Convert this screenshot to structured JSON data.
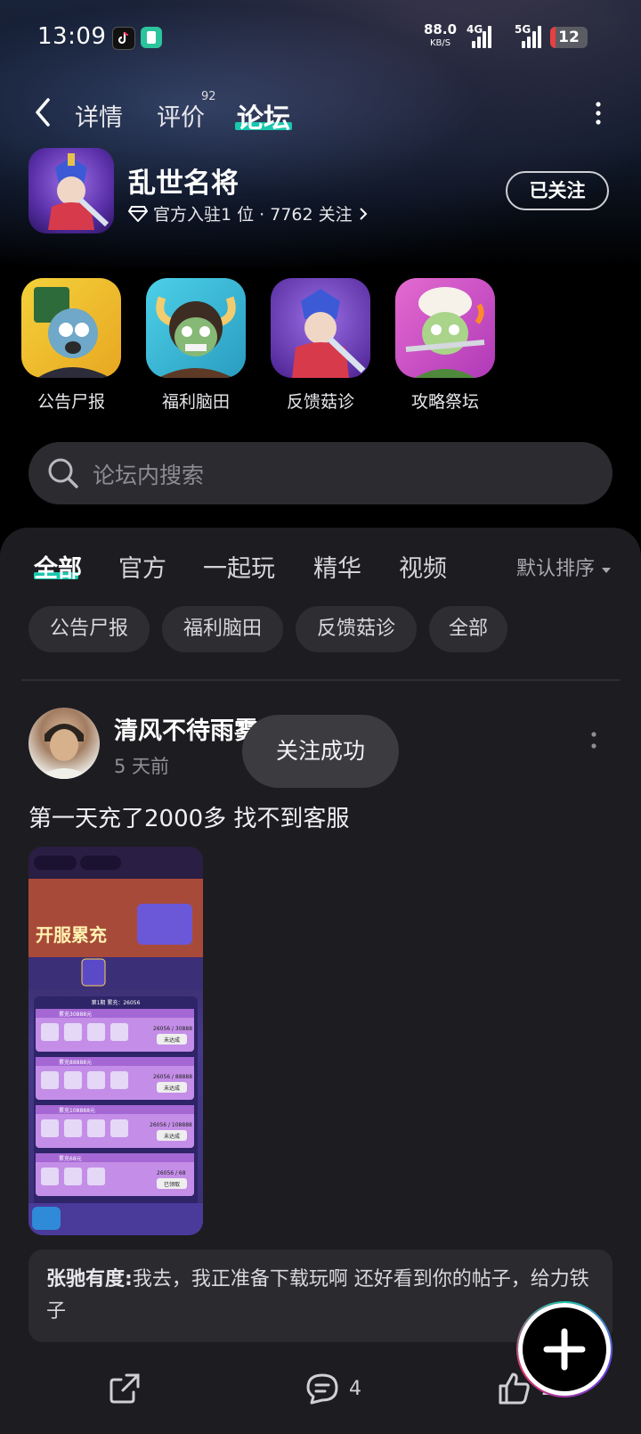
{
  "status_bar": {
    "time": "13:09",
    "net_speed": "88.0",
    "net_unit": "KB/S",
    "net1": "4G",
    "net2": "5G",
    "battery": "12"
  },
  "nav": {
    "tabs": [
      {
        "label": "详情"
      },
      {
        "label": "评价",
        "badge": "92"
      },
      {
        "label": "论坛"
      }
    ]
  },
  "game": {
    "title": "乱世名将",
    "meta": "官方入驻1 位 · 7762 关注",
    "follow_label": "已关注"
  },
  "sections": [
    {
      "label": "公告尸报"
    },
    {
      "label": "福利脑田"
    },
    {
      "label": "反馈菇诊"
    },
    {
      "label": "攻略祭坛"
    }
  ],
  "search": {
    "placeholder": "论坛内搜索"
  },
  "feed_tabs": [
    "全部",
    "官方",
    "一起玩",
    "精华",
    "视频"
  ],
  "sort_label": "默认排序",
  "chips": [
    "公告尸报",
    "福利脑田",
    "反馈菇诊",
    "全部"
  ],
  "post": {
    "author": "清风不待雨雾",
    "time": "5 天前",
    "text": "第一天充了2000多 找不到客服",
    "comment_author": "张驰有度:",
    "comment_text": "我去，我正准备下载玩啊 还好看到你的帖子，给力铁子",
    "comment_count": "4",
    "like_count": "2"
  },
  "toast": "关注成功",
  "image_texts": {
    "banner": "开服累充",
    "progress": "第1期 累充：26056",
    "rows": [
      {
        "tier": "累充30888元",
        "progress": "26056 / 30888",
        "status": "未达成"
      },
      {
        "tier": "累充88888元",
        "progress": "26056 / 88888",
        "status": "未达成"
      },
      {
        "tier": "累充108888元",
        "progress": "26056 / 108888",
        "status": "未达成"
      },
      {
        "tier": "累充68元",
        "progress": "26056 / 68",
        "status": "已领取"
      }
    ]
  },
  "colors": {
    "accent": "#19c7ad",
    "panel": "#1d1d21"
  }
}
